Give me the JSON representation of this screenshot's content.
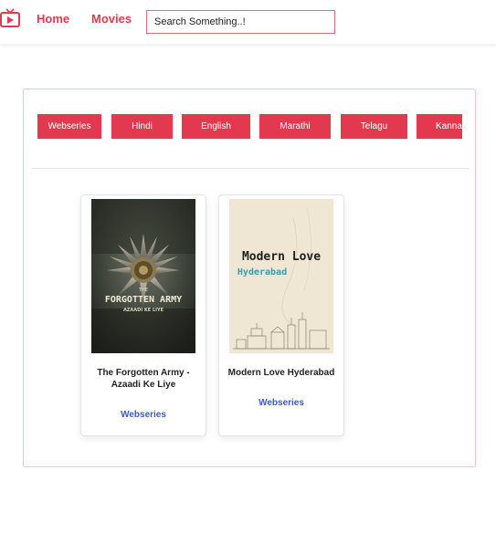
{
  "nav": {
    "home_label": "Home",
    "movies_label": "Movies",
    "search_placeholder": "Search Something..!",
    "accent_color": "#e23850"
  },
  "categories": [
    "Webseries",
    "Hindi",
    "English",
    "Marathi",
    "Telagu",
    "Kanna"
  ],
  "cards": [
    {
      "title": "The Forgotten Army - Azaadi Ke Liye",
      "tag": "Webseries",
      "poster_text_1": "THE",
      "poster_text_2": "FORGOTTEN ARMY",
      "poster_text_3": "AZAADI KE LIYE"
    },
    {
      "title": "Modern Love Hyderabad",
      "tag": "Webseries",
      "poster_text_1": "Modern Love",
      "poster_text_2": "Hyderabad"
    }
  ]
}
